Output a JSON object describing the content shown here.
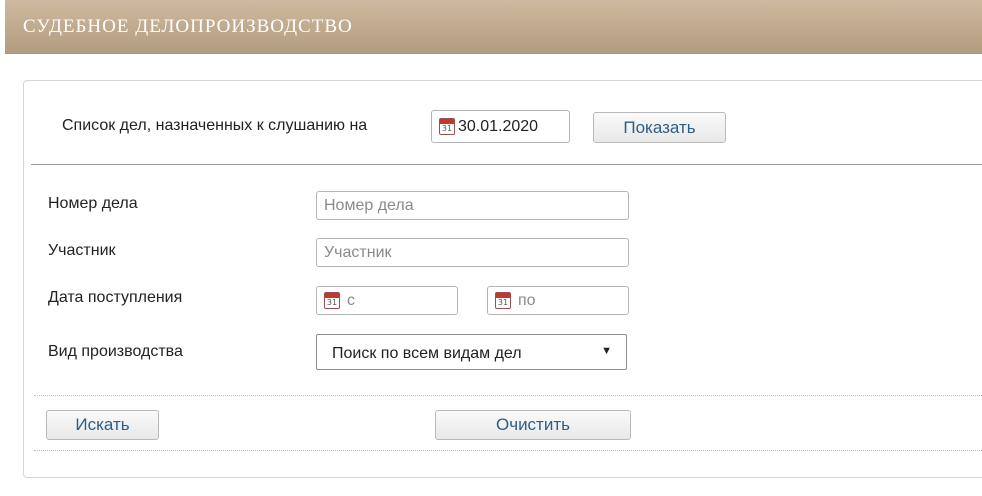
{
  "header": {
    "title": "Судебное делопроизводство"
  },
  "schedule": {
    "label": "Список дел, назначенных к слушанию на",
    "date_value": "30.01.2020",
    "show_button": "Показать"
  },
  "form": {
    "case_number": {
      "label": "Номер дела",
      "placeholder": "Номер дела"
    },
    "participant": {
      "label": "Участник",
      "placeholder": "Участник"
    },
    "receipt_date": {
      "label": "Дата поступления",
      "from_placeholder": "с",
      "to_placeholder": "по"
    },
    "proceeding_type": {
      "label": "Вид производства",
      "selected": "Поиск по всем видам дел"
    }
  },
  "actions": {
    "search_button": "Искать",
    "clear_button": "Очистить"
  },
  "icons": {
    "calendar": "calendar-icon",
    "dropdown": "dropdown-arrow-icon"
  },
  "colors": {
    "header_bg": "#c0aa8e",
    "button_text": "#2b5f8a"
  }
}
